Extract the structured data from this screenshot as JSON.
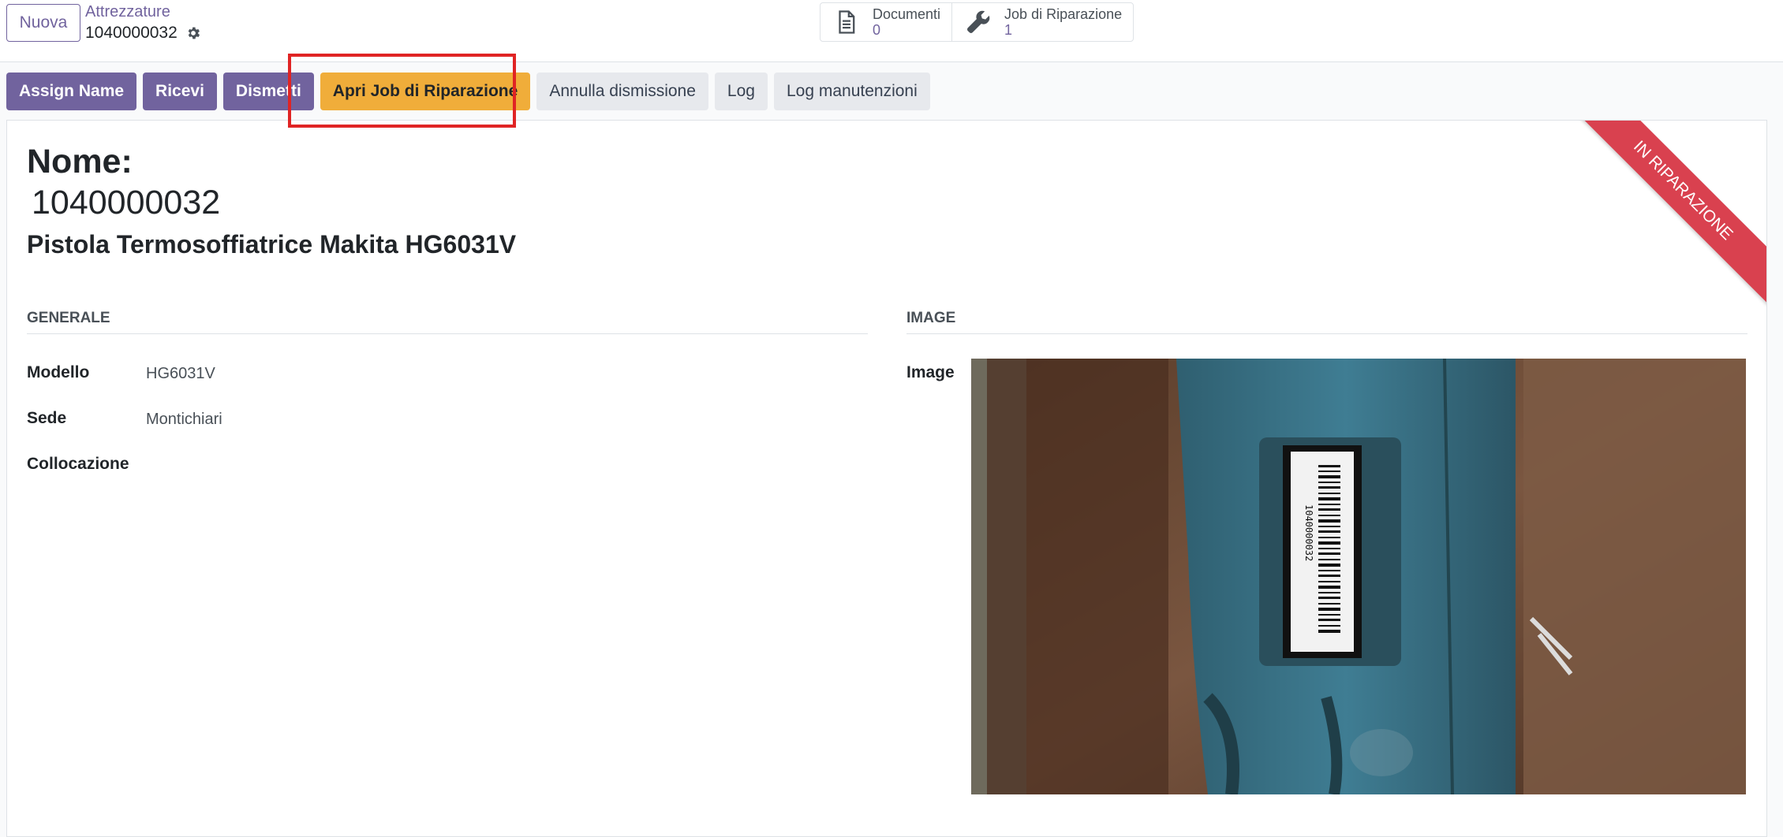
{
  "control_panel": {
    "new_button": "Nuova",
    "breadcrumb_parent": "Attrezzature",
    "breadcrumb_current": "1040000032",
    "smart_buttons": [
      {
        "label": "Documenti",
        "value": "0",
        "icon": "document-icon"
      },
      {
        "label": "Job di Riparazione",
        "value": "1",
        "icon": "wrench-icon"
      }
    ]
  },
  "statusbar": {
    "buttons": [
      {
        "label": "Assign Name",
        "style": "primary"
      },
      {
        "label": "Ricevi",
        "style": "primary"
      },
      {
        "label": "Dismetti",
        "style": "primary"
      },
      {
        "label": "Apri Job di Riparazione",
        "style": "warning"
      },
      {
        "label": "Annulla dismissione",
        "style": "secondary"
      },
      {
        "label": "Log",
        "style": "secondary"
      },
      {
        "label": "Log manutenzioni",
        "style": "secondary"
      }
    ]
  },
  "form": {
    "ribbon": "In Riparazione",
    "name_label": "Nome:",
    "name_value": "1040000032",
    "product_name": "Pistola Termosoffiatrice Makita HG6031V",
    "groups": {
      "generale": "Generale",
      "image": "Image"
    },
    "fields": {
      "modello_label": "Modello",
      "modello_value": "HG6031V",
      "sede_label": "Sede",
      "sede_value": "Montichiari",
      "collocazione_label": "Collocazione",
      "collocazione_value": ""
    },
    "image_label": "Image",
    "photo_barcode_text": "1040000032"
  },
  "colors": {
    "primary": "#71639e",
    "warning": "#f0ad3a",
    "ribbon": "#d9414f",
    "highlight": "#e02424"
  }
}
